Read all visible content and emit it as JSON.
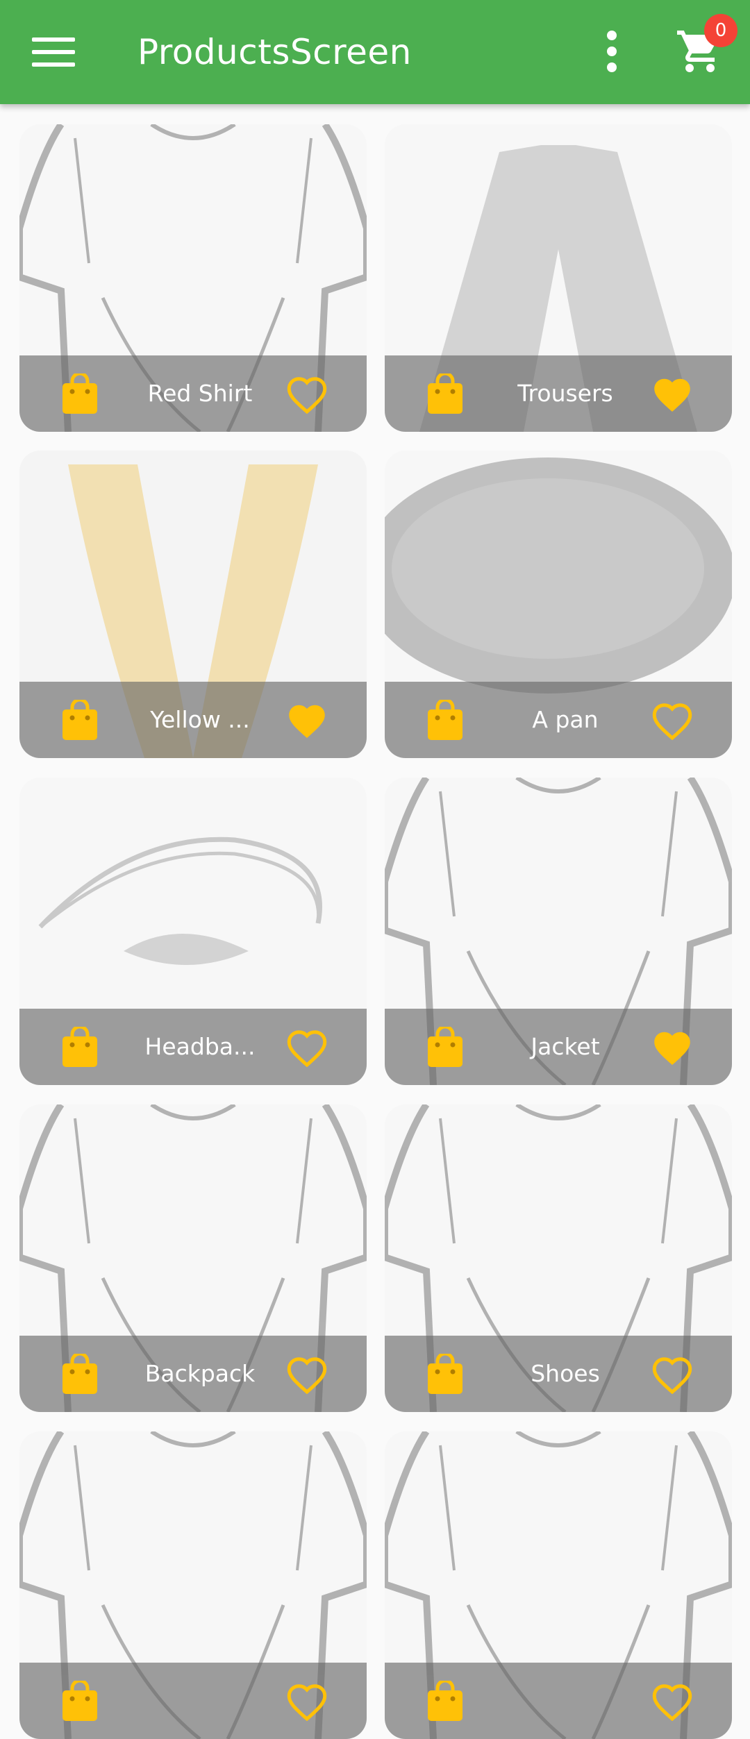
{
  "app_bar": {
    "title": "ProductsScreen",
    "menu_icon": "hamburger-menu-icon",
    "overflow_icon": "more-vert-icon",
    "cart_icon": "shopping-cart-icon",
    "cart_count": "0"
  },
  "colors": {
    "primary": "#4caf50",
    "accent": "#ffc107",
    "badge": "#f44336",
    "overlay": "#646464"
  },
  "products": [
    {
      "name": "Red Shirt",
      "favorite": false,
      "image": "t-shirt-sketch"
    },
    {
      "name": "Trousers",
      "favorite": true,
      "image": "trousers"
    },
    {
      "name": "Yellow ...",
      "favorite": true,
      "image": "yellow-scarf"
    },
    {
      "name": "A pan",
      "favorite": false,
      "image": "frying-pan"
    },
    {
      "name": "Headba...",
      "favorite": false,
      "image": "headband"
    },
    {
      "name": "Jacket",
      "favorite": true,
      "image": "t-shirt-sketch"
    },
    {
      "name": "Backpack",
      "favorite": false,
      "image": "t-shirt-sketch"
    },
    {
      "name": "Shoes",
      "favorite": false,
      "image": "t-shirt-sketch"
    },
    {
      "name": "",
      "favorite": false,
      "image": "t-shirt-sketch"
    },
    {
      "name": "",
      "favorite": false,
      "image": "t-shirt-sketch"
    }
  ]
}
